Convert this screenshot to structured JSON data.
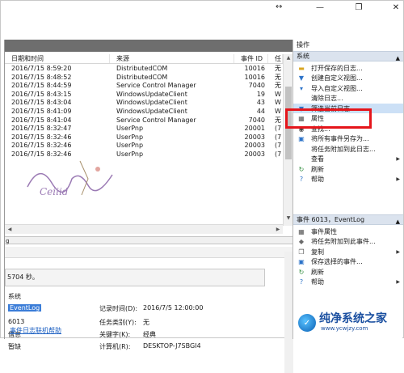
{
  "window": {
    "controls": [
      "↔",
      "—",
      "❐",
      "✕"
    ]
  },
  "event_list": {
    "columns": [
      "日期和时间",
      "来源",
      "事件 ID",
      "任"
    ],
    "rows": [
      [
        "2016/7/15 8:59:20",
        "DistributedCOM",
        "10016",
        "无"
      ],
      [
        "2016/7/15 8:48:52",
        "DistributedCOM",
        "10016",
        "无"
      ],
      [
        "2016/7/15 8:44:59",
        "Service Control Manager",
        "7040",
        "无"
      ],
      [
        "2016/7/15 8:43:15",
        "WindowsUpdateClient",
        "19",
        "W"
      ],
      [
        "2016/7/15 8:43:04",
        "WindowsUpdateClient",
        "43",
        "W"
      ],
      [
        "2016/7/15 8:41:09",
        "WindowsUpdateClient",
        "44",
        "W"
      ],
      [
        "2016/7/15 8:41:04",
        "Service Control Manager",
        "7040",
        "无"
      ],
      [
        "2016/7/15 8:32:47",
        "UserPnp",
        "20001",
        "(7"
      ],
      [
        "2016/7/15 8:32:46",
        "UserPnp",
        "20003",
        "(7"
      ],
      [
        "2016/7/15 8:32:46",
        "UserPnp",
        "20003",
        "(7"
      ],
      [
        "2016/7/15 8:32:46",
        "UserPnp",
        "20003",
        "(7"
      ]
    ]
  },
  "detail": {
    "splitter_label": "g",
    "message": "5704 秒。",
    "log_label": "系统",
    "log_value": "EventLog",
    "event_id": "6013",
    "level": "信息",
    "user": "暂缺",
    "logged_label": "记录时间(D):",
    "logged_value": "2016/7/5 12:00:00",
    "task_label": "任务类别(Y):",
    "task_value": "无",
    "keywords_label": "关键字(K):",
    "keywords_value": "经典",
    "computer_label": "计算机(R):",
    "computer_value": "DESKTOP-J7SBGI4",
    "help_link": "事件日志联机帮助"
  },
  "actions": {
    "title": "操作",
    "section1": "系统",
    "items1": [
      {
        "label": "打开保存的日志...",
        "icon": "folder-icon"
      },
      {
        "label": "创建自定义视图...",
        "icon": "filter-create-icon"
      },
      {
        "label": "导入自定义视图...",
        "icon": "import-icon"
      },
      {
        "label": "清除日志...",
        "icon": "none"
      },
      {
        "label": "筛选当前日志...",
        "icon": "filter-icon"
      },
      {
        "label": "属性",
        "icon": "properties-icon"
      },
      {
        "label": "查找...",
        "icon": "find-icon"
      },
      {
        "label": "将所有事件另存为...",
        "icon": "save-icon"
      },
      {
        "label": "将任务附加到此日志...",
        "icon": "none"
      },
      {
        "label": "查看",
        "icon": "none",
        "sub": true
      },
      {
        "label": "刷新",
        "icon": "refresh-icon"
      },
      {
        "label": "帮助",
        "icon": "help-icon",
        "sub": true
      }
    ],
    "section2": "事件 6013，EventLog",
    "items2": [
      {
        "label": "事件属性",
        "icon": "event-props-icon"
      },
      {
        "label": "将任务附加到此事件...",
        "icon": "task-icon"
      },
      {
        "label": "复制",
        "icon": "copy-icon",
        "sub": true
      },
      {
        "label": "保存选择的事件...",
        "icon": "save-icon"
      },
      {
        "label": "刷新",
        "icon": "refresh-icon"
      },
      {
        "label": "帮助",
        "icon": "help-icon",
        "sub": true
      }
    ]
  },
  "logo": {
    "title": "纯净系统之家",
    "url": "www.ycwjzy.com"
  },
  "watermark": "Ceiiid"
}
